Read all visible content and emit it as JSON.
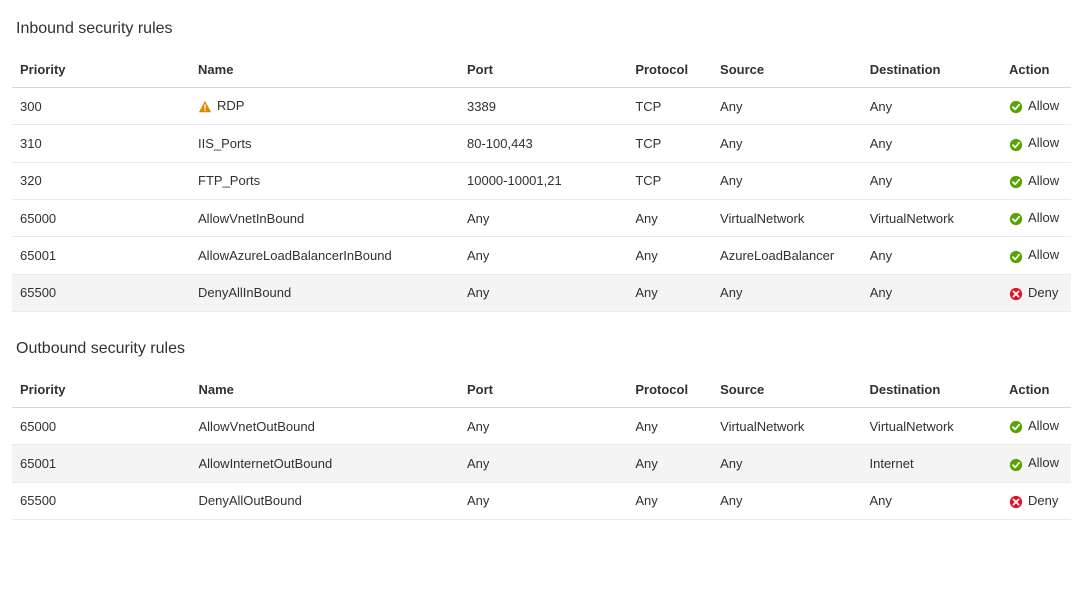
{
  "inbound": {
    "title": "Inbound security rules",
    "headers": {
      "priority": "Priority",
      "name": "Name",
      "port": "Port",
      "protocol": "Protocol",
      "source": "Source",
      "destination": "Destination",
      "action": "Action"
    },
    "rows": [
      {
        "priority": "300",
        "name": "RDP",
        "warning": true,
        "port": "3389",
        "protocol": "TCP",
        "source": "Any",
        "destination": "Any",
        "action": "Allow",
        "alt": false
      },
      {
        "priority": "310",
        "name": "IIS_Ports",
        "warning": false,
        "port": "80-100,443",
        "protocol": "TCP",
        "source": "Any",
        "destination": "Any",
        "action": "Allow",
        "alt": false
      },
      {
        "priority": "320",
        "name": "FTP_Ports",
        "warning": false,
        "port": "10000-10001,21",
        "protocol": "TCP",
        "source": "Any",
        "destination": "Any",
        "action": "Allow",
        "alt": false
      },
      {
        "priority": "65000",
        "name": "AllowVnetInBound",
        "warning": false,
        "port": "Any",
        "protocol": "Any",
        "source": "VirtualNetwork",
        "destination": "VirtualNetwork",
        "action": "Allow",
        "alt": false
      },
      {
        "priority": "65001",
        "name": "AllowAzureLoadBalancerInBound",
        "warning": false,
        "port": "Any",
        "protocol": "Any",
        "source": "AzureLoadBalancer",
        "destination": "Any",
        "action": "Allow",
        "alt": false
      },
      {
        "priority": "65500",
        "name": "DenyAllInBound",
        "warning": false,
        "port": "Any",
        "protocol": "Any",
        "source": "Any",
        "destination": "Any",
        "action": "Deny",
        "alt": true
      }
    ]
  },
  "outbound": {
    "title": "Outbound security rules",
    "headers": {
      "priority": "Priority",
      "name": "Name",
      "port": "Port",
      "protocol": "Protocol",
      "source": "Source",
      "destination": "Destination",
      "action": "Action"
    },
    "rows": [
      {
        "priority": "65000",
        "name": "AllowVnetOutBound",
        "warning": false,
        "port": "Any",
        "protocol": "Any",
        "source": "VirtualNetwork",
        "destination": "VirtualNetwork",
        "action": "Allow",
        "alt": false
      },
      {
        "priority": "65001",
        "name": "AllowInternetOutBound",
        "warning": false,
        "port": "Any",
        "protocol": "Any",
        "source": "Any",
        "destination": "Internet",
        "action": "Allow",
        "alt": true
      },
      {
        "priority": "65500",
        "name": "DenyAllOutBound",
        "warning": false,
        "port": "Any",
        "protocol": "Any",
        "source": "Any",
        "destination": "Any",
        "action": "Deny",
        "alt": false
      }
    ]
  },
  "icons": {
    "warning": "warning-icon",
    "allow": "allow-icon",
    "deny": "deny-icon"
  }
}
